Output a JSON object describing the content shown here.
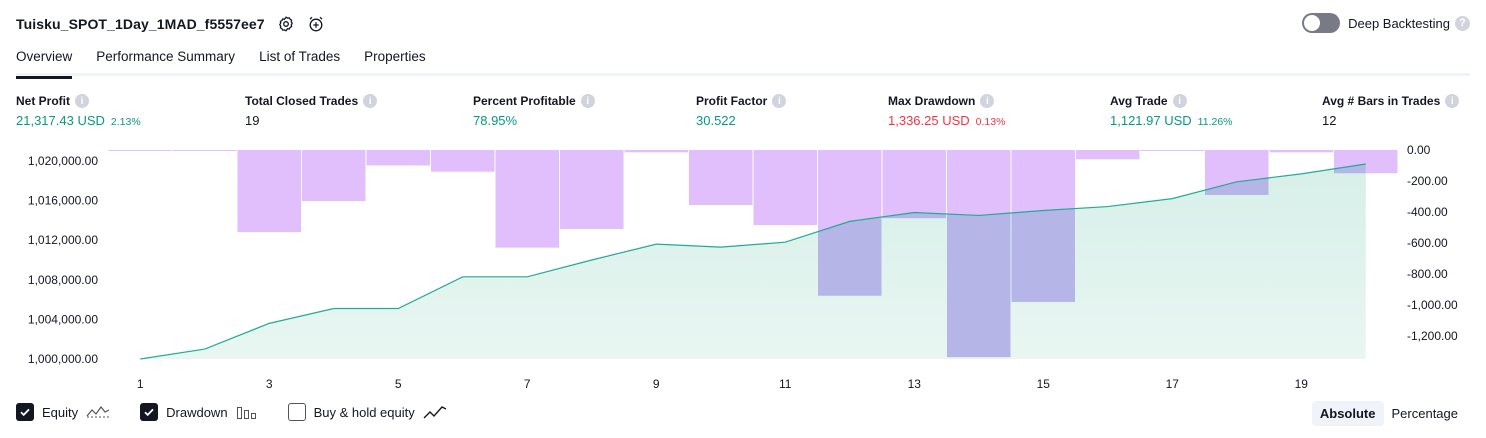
{
  "strategy_title": "Tuisku_SPOT_1Day_1MAD_f5557ee7",
  "header_icons": [
    "settings-icon",
    "alarm-add-icon"
  ],
  "deep_backtesting": {
    "label": "Deep Backtesting",
    "enabled": false,
    "help": "?"
  },
  "tabs": [
    {
      "label": "Overview",
      "active": true
    },
    {
      "label": "Performance Summary",
      "active": false
    },
    {
      "label": "List of Trades",
      "active": false
    },
    {
      "label": "Properties",
      "active": false
    }
  ],
  "stats": {
    "net_profit": {
      "label": "Net Profit",
      "value": "21,317.43 USD",
      "sub": "2.13%",
      "color": "#089981"
    },
    "total_closed_trades": {
      "label": "Total Closed Trades",
      "value": "19",
      "color": "#131722"
    },
    "percent_profitable": {
      "label": "Percent Profitable",
      "value": "78.95%",
      "color": "#089981"
    },
    "profit_factor": {
      "label": "Profit Factor",
      "value": "30.522",
      "color": "#089981"
    },
    "max_drawdown": {
      "label": "Max Drawdown",
      "value": "1,336.25 USD",
      "sub": "0.13%",
      "color": "#f23645"
    },
    "avg_trade": {
      "label": "Avg Trade",
      "value": "1,121.97 USD",
      "sub": "11.26%",
      "color": "#089981"
    },
    "avg_bars": {
      "label": "Avg # Bars in Trades",
      "value": "12",
      "color": "#131722"
    }
  },
  "info_glyph": "i",
  "chart_data": {
    "type": "line+bar",
    "x": [
      1,
      2,
      3,
      4,
      5,
      6,
      7,
      8,
      9,
      10,
      11,
      12,
      13,
      14,
      15,
      16,
      17,
      18,
      19,
      20
    ],
    "x_tick_labels": [
      "1",
      "3",
      "5",
      "7",
      "9",
      "11",
      "13",
      "15",
      "17",
      "19"
    ],
    "series": [
      {
        "name": "Equity",
        "axis": "left",
        "values": [
          1000000,
          1001000,
          1003600,
          1005100,
          1005100,
          1008300,
          1008300,
          1010000,
          1011600,
          1011300,
          1011800,
          1013900,
          1014800,
          1014500,
          1015000,
          1015400,
          1016200,
          1017900,
          1018700,
          1019700
        ]
      },
      {
        "name": "Drawdown",
        "axis": "right",
        "values": [
          -5,
          -5,
          -530,
          -330,
          -100,
          -140,
          -630,
          -510,
          -15,
          -355,
          -485,
          -940,
          -440,
          -1336.25,
          -980,
          -60,
          -5,
          -290,
          -15,
          -150
        ]
      }
    ],
    "left_axis": {
      "ticks": [
        1000000,
        1004000,
        1008000,
        1012000,
        1016000,
        1020000
      ],
      "tick_labels": [
        "1,000,000.00",
        "1,004,000.00",
        "1,008,000.00",
        "1,012,000.00",
        "1,016,000.00",
        "1,020,000.00"
      ],
      "range": [
        1000000,
        1020000
      ]
    },
    "right_axis": {
      "ticks": [
        0,
        -200,
        -400,
        -600,
        -800,
        -1000,
        -1200
      ],
      "tick_labels": [
        "0.00",
        "-200.00",
        "-400.00",
        "-600.00",
        "-800.00",
        "-1,000.00",
        "-1,200.00"
      ],
      "range": [
        -1336.25,
        0
      ]
    },
    "colors": {
      "equity_line": "#22ab94",
      "equity_fill": "#d7efe8",
      "drawdown_bar": "#e1bffc",
      "drawdown_overlap": "#b5b5e8"
    },
    "grid": false
  },
  "legend": [
    {
      "label": "Equity",
      "checked": true,
      "icon": "equity-wave-icon"
    },
    {
      "label": "Drawdown",
      "checked": true,
      "icon": "drawdown-bars-icon"
    },
    {
      "label": "Buy & hold equity",
      "checked": false,
      "icon": "buy-hold-line-icon"
    }
  ],
  "modes": [
    {
      "label": "Absolute",
      "active": true
    },
    {
      "label": "Percentage",
      "active": false
    }
  ]
}
